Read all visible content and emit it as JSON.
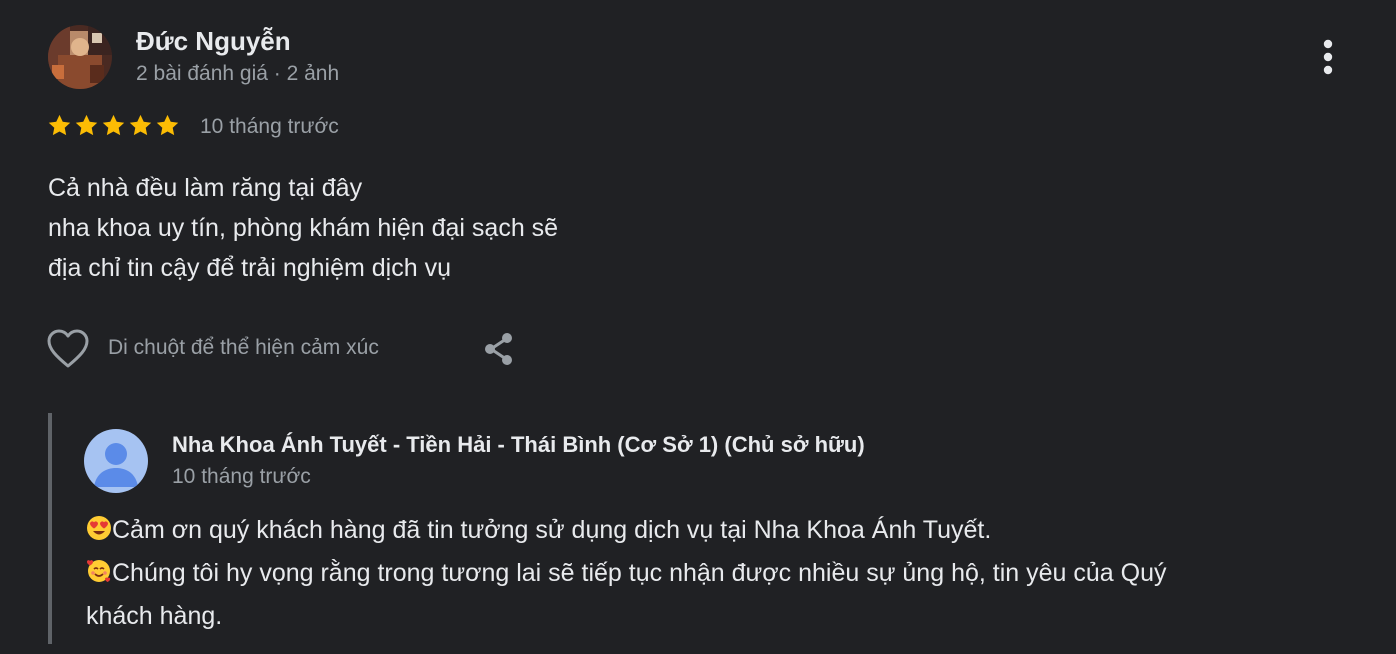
{
  "review": {
    "reviewer": {
      "name": "Đức Nguyễn",
      "meta": "2 bài đánh giá · 2 ảnh"
    },
    "rating": 5,
    "time": "10 tháng trước",
    "text_lines": [
      "Cả nhà đều làm răng tại đây",
      "nha khoa uy tín, phòng khám hiện đại sạch sẽ",
      "địa chỉ tin cậy để trải nghiệm dịch vụ"
    ],
    "actions": {
      "reaction_hint": "Di chuột để thể hiện cảm xúc"
    }
  },
  "reply": {
    "owner_name": "Nha Khoa Ánh Tuyết - Tiền Hải - Thái Bình (Cơ Sở 1) (Chủ sở hữu)",
    "time": "10 tháng trước",
    "lines": [
      {
        "emoji": "heart-eyes-emoji",
        "text": "Cảm ơn quý khách hàng đã tin tưởng sử dụng dịch vụ tại Nha Khoa Ánh Tuyết."
      },
      {
        "emoji": "smiling-hearts-emoji",
        "text": "Chúng tôi hy vọng rằng trong tương lai sẽ tiếp tục nhận được nhiều sự ủng hộ, tin yêu của Quý"
      },
      {
        "emoji": "",
        "text": "khách hàng."
      }
    ]
  },
  "colors": {
    "background": "#202124",
    "text_primary": "#e8eaed",
    "text_secondary": "#9aa0a6",
    "star": "#fbbc04",
    "reply_border": "#5f6368",
    "owner_avatar_bg": "#a6c3f2",
    "owner_avatar_fg": "#5b8be8"
  },
  "icons": {
    "more": "more-vert-icon",
    "like": "heart-outline-icon",
    "share": "share-icon",
    "star": "star-icon"
  }
}
